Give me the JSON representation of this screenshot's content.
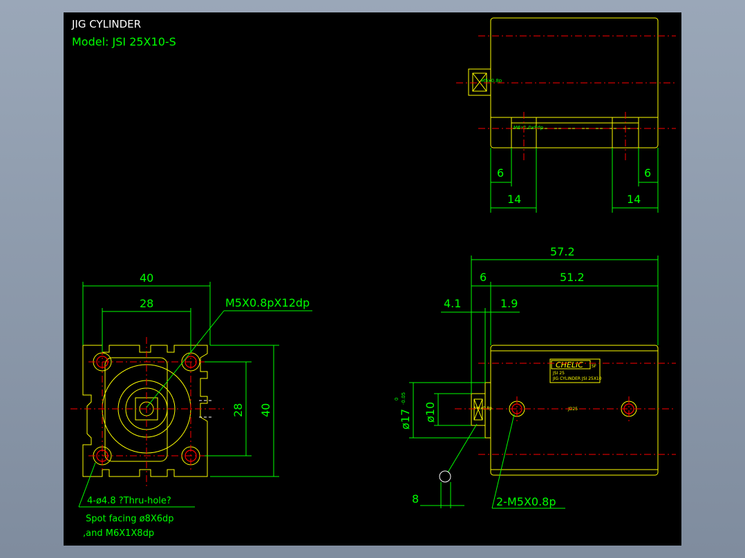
{
  "title": "JIG CYLINDER",
  "model": "Model:  JSI 25X10-S",
  "top_view": {
    "port_label": "M5x0.8p",
    "thread_label": "M6x1.0x8dp",
    "dim_left_inner": "6",
    "dim_right_inner": "6",
    "dim_left_outer": "14",
    "dim_right_outer": "14"
  },
  "front_view": {
    "dim_outer_width": "40",
    "dim_hole_pitch": "28",
    "port_callout": "M5X0.8pX12dp",
    "dim_hole_pitch_v": "28",
    "dim_outer_height": "40",
    "hole_note_1": "4-ø4.8 ?Thru-hole?",
    "hole_note_2": "Spot facing  ø8X6dp",
    "hole_note_3": ",and  M6X1X8dp"
  },
  "side_view": {
    "dim_total": "57.2",
    "dim_rod": "6",
    "dim_body": "51.2",
    "dim_a": "4.1",
    "dim_b": "1.9",
    "dim_d17": "ø17",
    "tol_upper": "0",
    "tol_lower": "-0.05",
    "dim_d10": "ø10",
    "dim_8": "8",
    "port_callout": "2-M5X0.8p",
    "brand": "CHELIC",
    "brand_suffix": "SF",
    "plate_line_1": "JSI 25",
    "plate_line_2": "JIG CYLINDER JSI 25X10",
    "body_mark": "JD25",
    "rod_label": "M6x0.8p"
  }
}
